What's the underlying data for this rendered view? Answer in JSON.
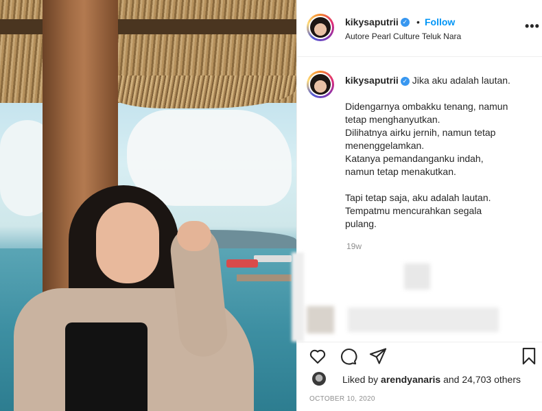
{
  "post": {
    "username": "kikysaputrii",
    "location": "Autore Pearl Culture Teluk Nara",
    "follow_label": "Follow",
    "dot": "•",
    "more_label": "•••",
    "verified_icon": "✓",
    "caption": {
      "username": "kikysaputrii",
      "first_line": "Jika aku adalah lautan.",
      "paragraph1": [
        "Didengarnya ombakku tenang, namun",
        "tetap menghanyutkan.",
        "Dilihatnya airku jernih, namun tetap",
        "menenggelamkan.",
        "Katanya pemandanganku indah,",
        "namun tetap menakutkan."
      ],
      "paragraph2": [
        "Tapi tetap saja, aku adalah lautan.",
        "Tempatmu mencurahkan segala",
        "pulang."
      ]
    },
    "age": "19w",
    "likes": {
      "prefix": "Liked by",
      "liker": "arendyanaris",
      "suffix": "and 24,703 others"
    },
    "date": "OCTOBER 10, 2020"
  },
  "icons": {
    "like": "heart-icon",
    "comment": "comment-icon",
    "share": "share-icon",
    "save": "bookmark-icon"
  },
  "colors": {
    "accent": "#0095f6",
    "verified": "#3897f0",
    "muted": "#8e8e8e",
    "text": "#262626"
  }
}
